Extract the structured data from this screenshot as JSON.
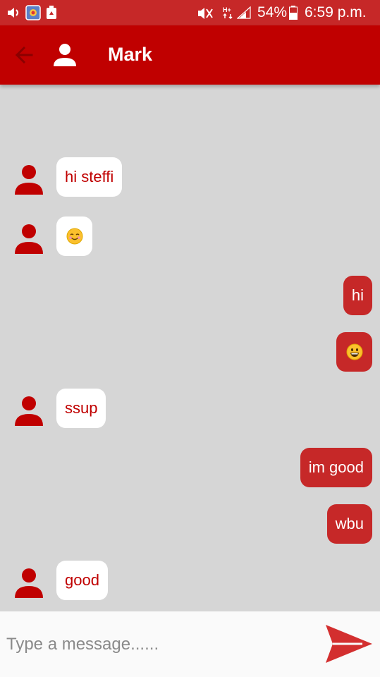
{
  "status_bar": {
    "battery": "54%",
    "time": "6:59 p.m.",
    "network": "H+",
    "icons": [
      "volume-icon",
      "app-notification-icon",
      "recycle-notification-icon",
      "mute-icon",
      "network-type-icon",
      "signal-icon",
      "battery-icon"
    ]
  },
  "header": {
    "title": "Mark",
    "back_icon": "arrow-left-icon",
    "avatar_icon": "person-icon"
  },
  "messages": [
    {
      "direction": "incoming",
      "text": "hi steffi"
    },
    {
      "direction": "incoming",
      "emoji": "smiling-face-emoji"
    },
    {
      "direction": "outgoing",
      "text": "hi"
    },
    {
      "direction": "outgoing",
      "emoji": "grinning-face-emoji"
    },
    {
      "direction": "incoming",
      "text": "ssup"
    },
    {
      "direction": "outgoing",
      "text": "im good"
    },
    {
      "direction": "outgoing",
      "text": "wbu"
    },
    {
      "direction": "incoming",
      "text": "good"
    }
  ],
  "composer": {
    "placeholder": "Type a message......",
    "value": "",
    "send_icon": "send-icon"
  },
  "colors": {
    "primary": "#c00000",
    "status_bar": "#c62828",
    "outgoing_bubble": "#c62828",
    "incoming_bubble": "#ffffff",
    "chat_background": "#d6d6d6"
  }
}
